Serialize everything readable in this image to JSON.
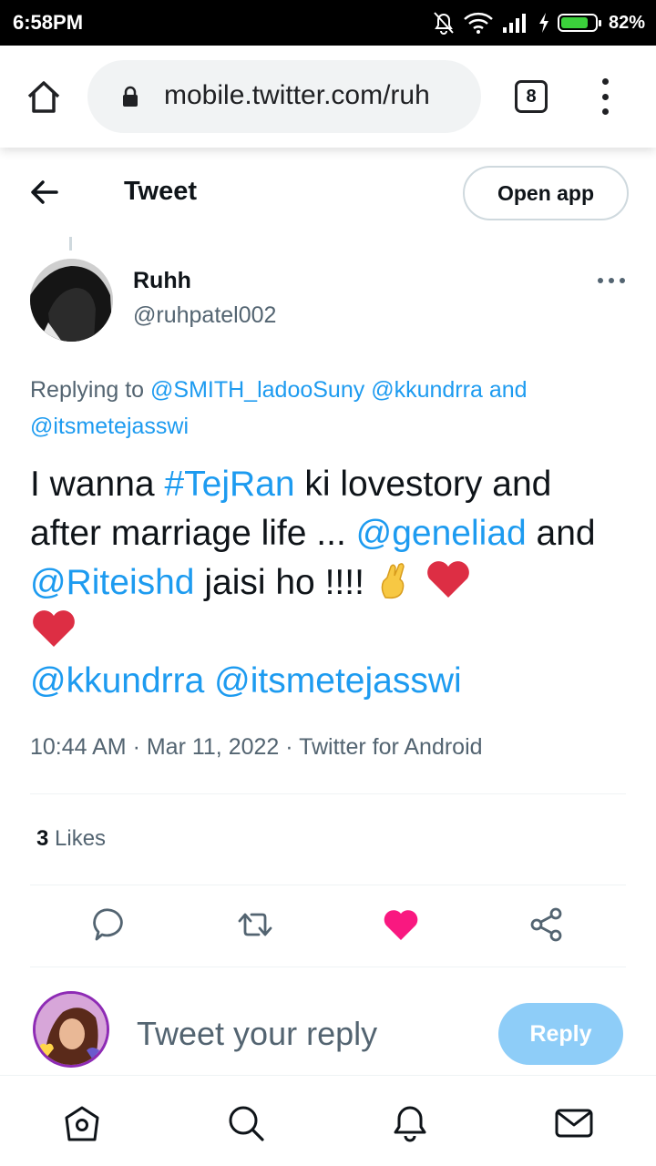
{
  "status_bar": {
    "time": "6:58PM",
    "battery_percent": "82%",
    "battery_level": 0.82,
    "icons": [
      "bell-off-icon",
      "wifi-icon",
      "signal-icon",
      "charging-icon",
      "battery-icon"
    ]
  },
  "browser": {
    "url": "mobile.twitter.com/ruh",
    "tab_count": "8"
  },
  "header": {
    "title": "Tweet",
    "open_app_label": "Open app"
  },
  "tweet": {
    "author_name": "Ruhh",
    "author_handle": "@ruhpatel002",
    "replying_prefix": "Replying to",
    "replying_mention_1": "@SMITH_ladooSuny",
    "replying_mention_2": "@kkundrra",
    "replying_and": "and",
    "replying_mention_3": "@itsmetejasswi",
    "text_1": "I wanna ",
    "hashtag": "#TejRan",
    "text_2": "  ki lovestory and after marriage life ... ",
    "mention_1": "@geneliad",
    "text_3": " and ",
    "mention_2": "@Riteishd",
    "text_4": "  jaisi ho !!!! ",
    "mention_3": "@kkundrra",
    "mention_4": "@itsmetejasswi",
    "meta": "10:44 AM · Mar 11, 2022 · Twitter for Android",
    "likes_count": "3",
    "likes_label": "Likes"
  },
  "composer": {
    "placeholder": "Tweet your reply",
    "reply_label": "Reply"
  },
  "colors": {
    "link": "#1d9bf0",
    "like_active": "#f91880",
    "reply_button": "#8ecdf8",
    "secondary_text": "#536471"
  }
}
